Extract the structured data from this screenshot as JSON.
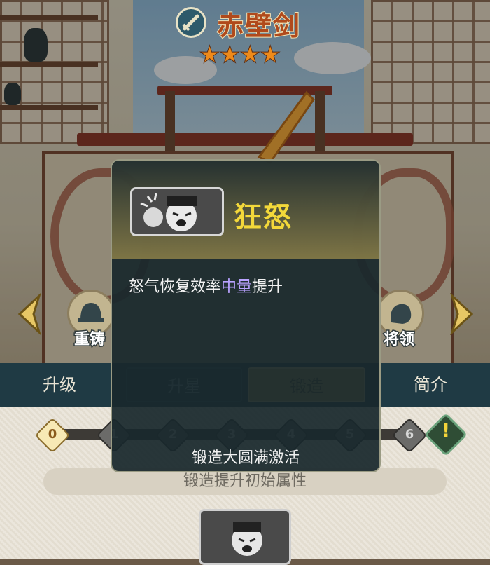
{
  "header": {
    "title": "赤壁剑",
    "stars": 4,
    "star_glyph": "★"
  },
  "side": {
    "left_button_label": "重铸",
    "right_button_label": "将领",
    "left_arrow": "chevron-left-icon",
    "right_arrow": "chevron-right-icon"
  },
  "tabs": [
    {
      "label": "升级"
    },
    {
      "label": "升星"
    },
    {
      "label": "锻造"
    },
    {
      "label": "简介"
    }
  ],
  "forge": {
    "levels": [
      "0",
      "1",
      "2",
      "3",
      "4",
      "5",
      "6"
    ],
    "warning_mark": "!",
    "hint": "锻造提升初始属性"
  },
  "popup": {
    "skill_name": "狂怒",
    "desc_before": "怒气恢复效率",
    "desc_highlight": "中量",
    "desc_after": "提升",
    "footer": "锻造大圆满激活"
  },
  "colors": {
    "title": "#b04a1c",
    "star": "#ee8a1a",
    "skill_name": "#f3d83a",
    "highlight": "#b9a2ff",
    "tab_bar": "#1f3a44"
  }
}
